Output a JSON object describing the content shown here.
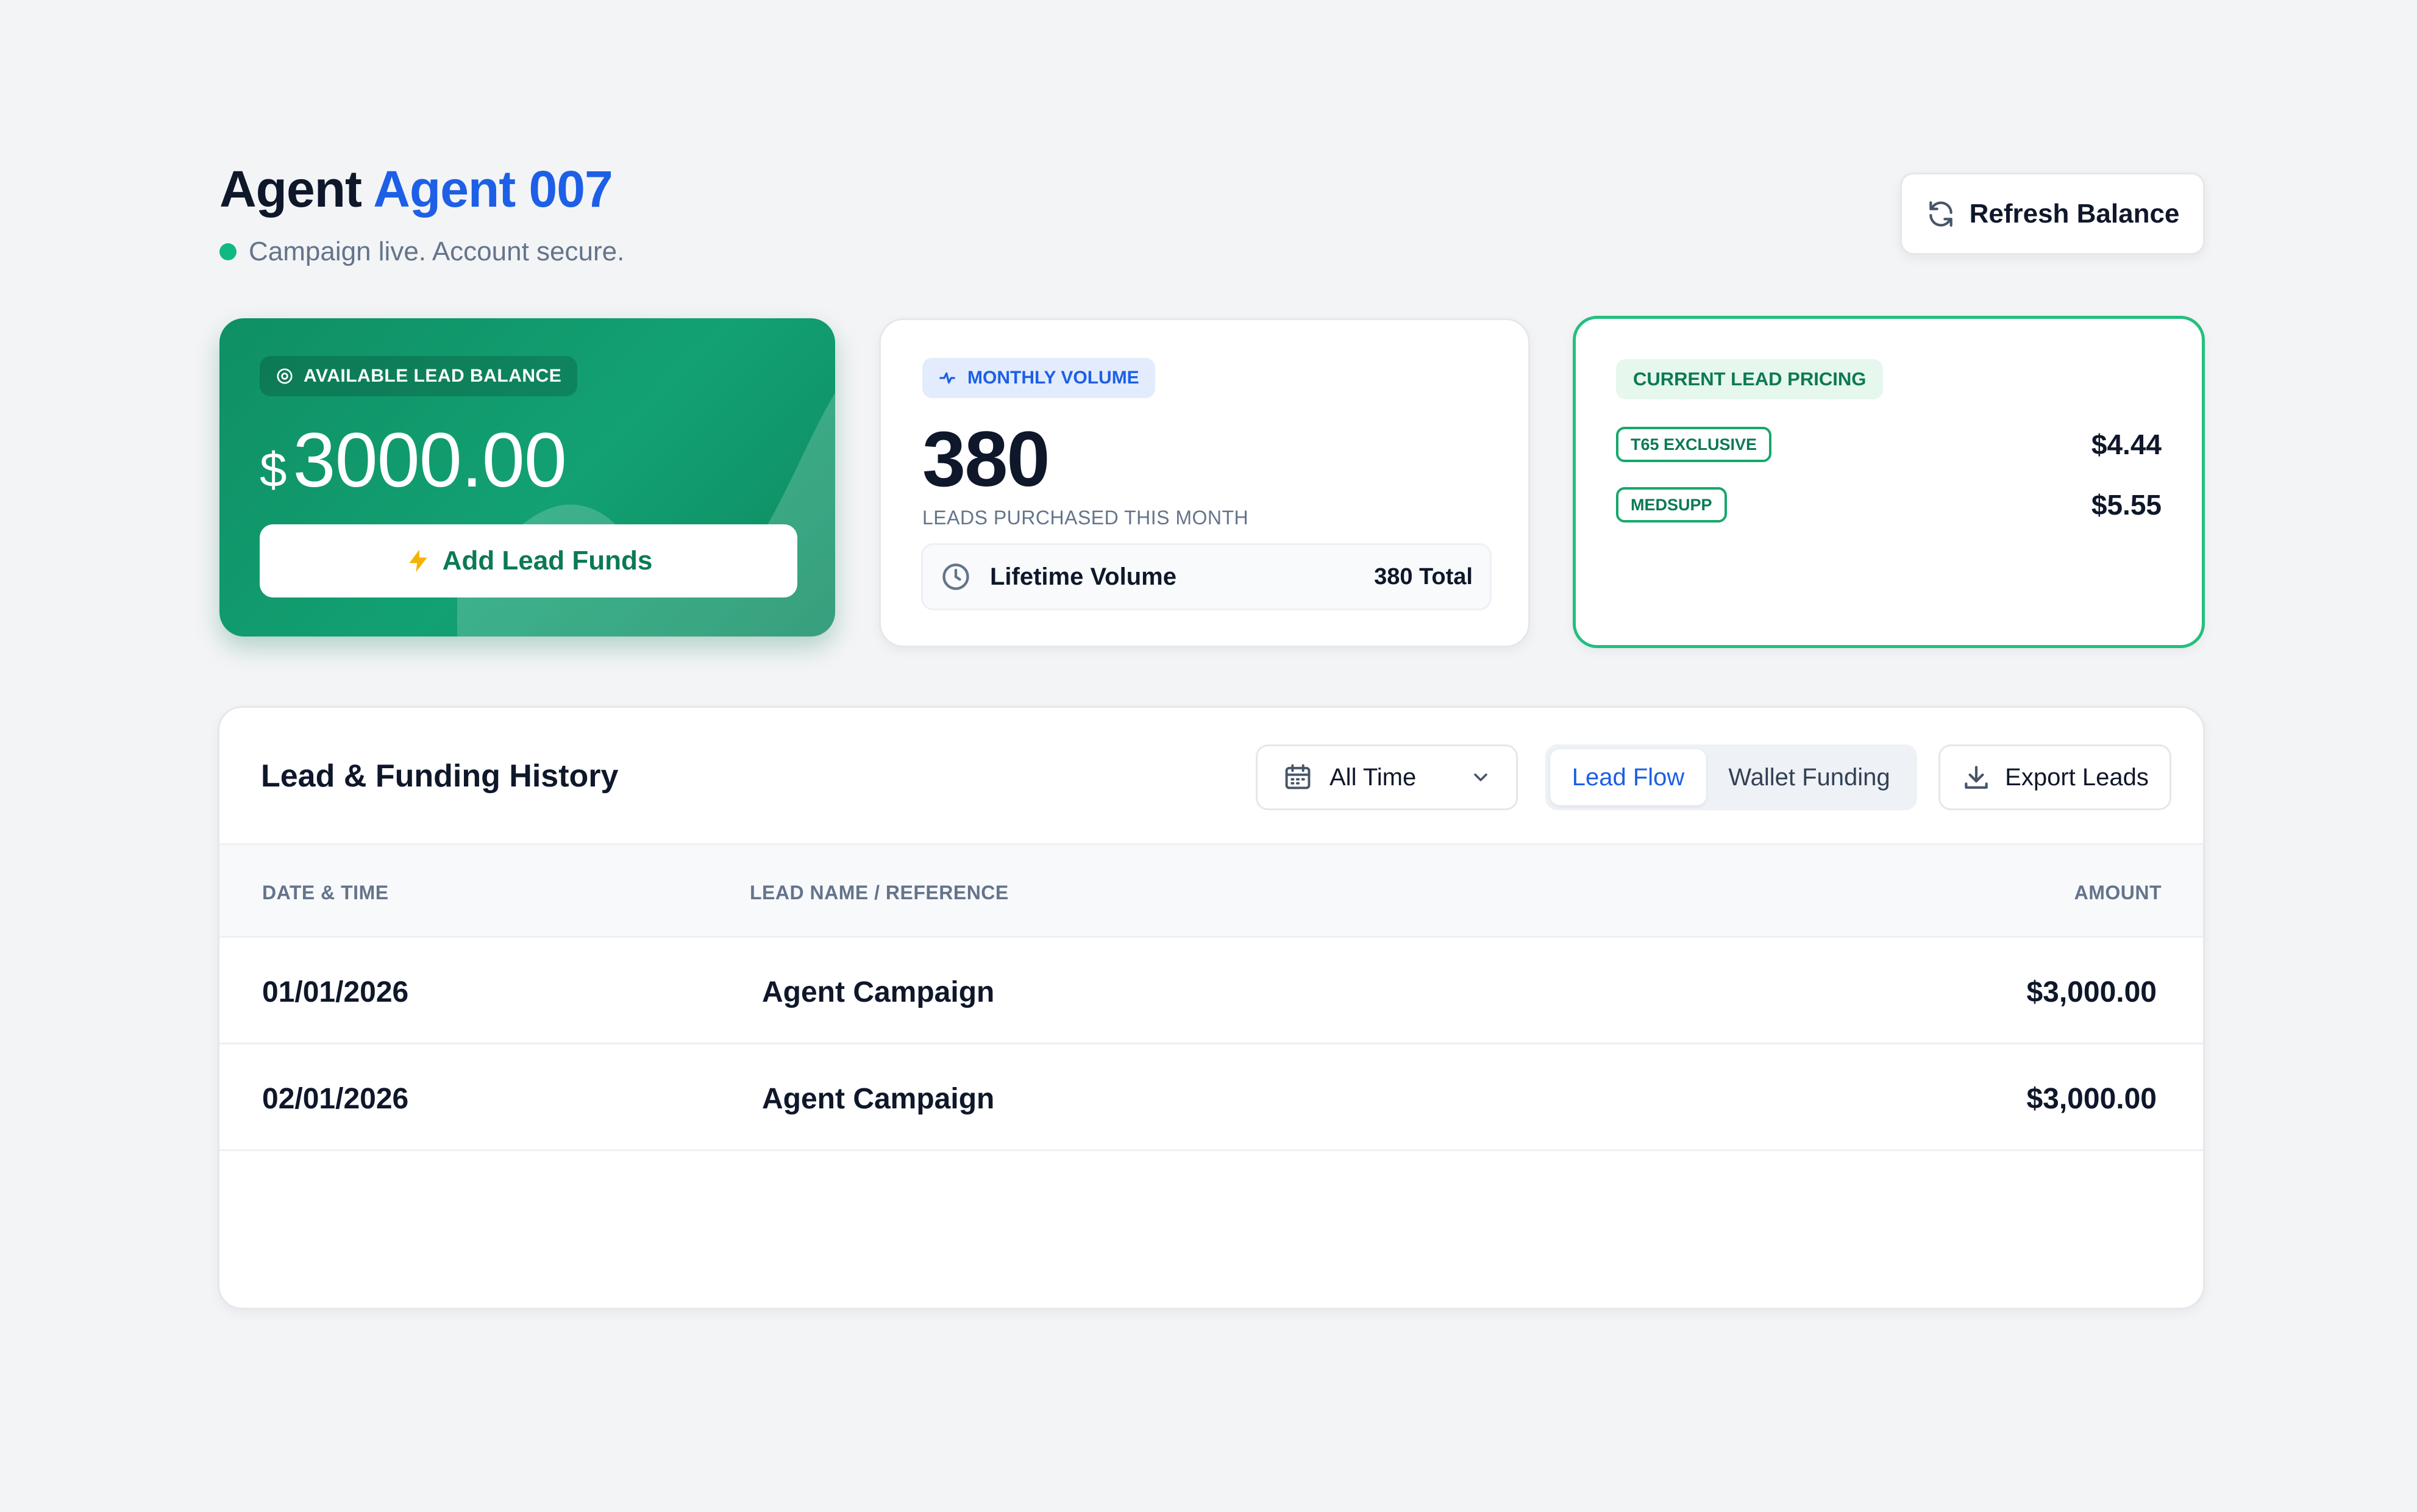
{
  "header": {
    "title_prefix": "Agent",
    "title_name": "Agent 007",
    "status_text": "Campaign live. Account secure.",
    "status_color": "#10b981",
    "refresh_label": "Refresh Balance",
    "refresh_icon": "refresh-icon"
  },
  "balance_card": {
    "label": "AVAILABLE LEAD BALANCE",
    "currency": "$",
    "amount": "3000.00",
    "button_label": "Add Lead Funds",
    "button_icon": "lightning-icon",
    "accent": "#12a173"
  },
  "volume_card": {
    "label": "MONTHLY VOLUME",
    "value": "380",
    "subtitle": "LEADS PURCHASED THIS MONTH",
    "lifetime_label": "Lifetime Volume",
    "lifetime_total": "380 Total"
  },
  "pricing_card": {
    "label": "CURRENT LEAD PRICING",
    "items": [
      {
        "name": "T65 EXCLUSIVE",
        "price": "$4.44"
      },
      {
        "name": "MEDSUPP",
        "price": "$5.55"
      }
    ]
  },
  "history": {
    "title": "Lead & Funding History",
    "filter_value": "All Time",
    "tabs": [
      {
        "label": "Lead Flow",
        "active": true
      },
      {
        "label": "Wallet Funding",
        "active": false
      }
    ],
    "export_label": "Export Leads",
    "columns": [
      "DATE & TIME",
      "LEAD NAME / REFERENCE",
      "AMOUNT"
    ],
    "rows": [
      {
        "date": "01/01/2026",
        "name": "Agent Campaign",
        "amount": "$3,000.00"
      },
      {
        "date": "02/01/2026",
        "name": "Agent Campaign",
        "amount": "$3,000.00"
      }
    ]
  }
}
